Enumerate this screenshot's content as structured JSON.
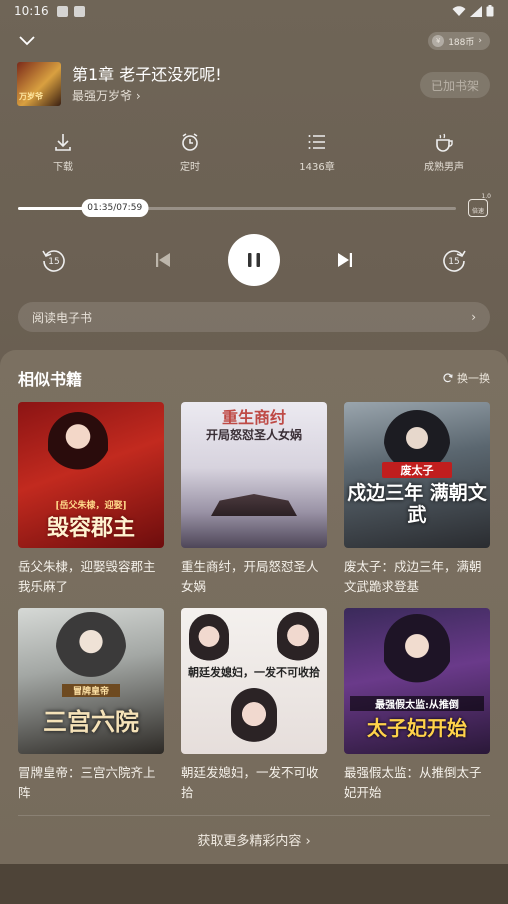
{
  "status_bar": {
    "time": "10:16"
  },
  "header": {
    "coin_text": "188币",
    "coin_symbol": "¥"
  },
  "book": {
    "chapter_title": "第1章 老子还没死呢!",
    "book_name": "最强万岁爷 ›",
    "cover_text": "万岁爷",
    "shelf_label": "已加书架"
  },
  "tools": [
    {
      "label": "下载",
      "icon": "download-icon"
    },
    {
      "label": "定时",
      "icon": "timer-icon"
    },
    {
      "label": "1436章",
      "icon": "chapter-list-icon"
    },
    {
      "label": "成熟男声",
      "icon": "voice-icon"
    }
  ],
  "player": {
    "progress_text": "01:35/07:59",
    "progress_fraction": 0.198,
    "speed_value": "1.0",
    "speed_label": "倍速",
    "rewind_label": "15",
    "forward_label": "15"
  },
  "read_ebook": {
    "label": "阅读电子书",
    "chevron": "›"
  },
  "similar": {
    "title": "相似书籍",
    "refresh_label": "换一换",
    "books": [
      {
        "title": "岳父朱棣，迎娶毁容郡主我乐麻了",
        "cover_text": "毁容郡主",
        "cover_sub": "[岳父朱棣，迎娶]"
      },
      {
        "title": "重生商纣，开局怒怼圣人女娲",
        "cover_text": "开局怒怼圣人女娲",
        "cover_sub": "重生商纣"
      },
      {
        "title": "废太子：戍边三年，满朝文武跪求登基",
        "cover_text": "戍边三年 满朝文武",
        "cover_sub": "废太子"
      },
      {
        "title": "冒牌皇帝：三宫六院齐上阵",
        "cover_text": "三宫六院",
        "cover_sub": "冒牌皇帝"
      },
      {
        "title": "朝廷发媳妇，一发不可收拾",
        "cover_text": "朝廷发媳妇，一发不可收拾",
        "cover_sub": ""
      },
      {
        "title": "最强假太监：从推倒太子妃开始",
        "cover_text": "太子妃开始",
        "cover_sub": "最强假太监:从推倒"
      }
    ],
    "more_label": "获取更多精彩内容 ›"
  }
}
